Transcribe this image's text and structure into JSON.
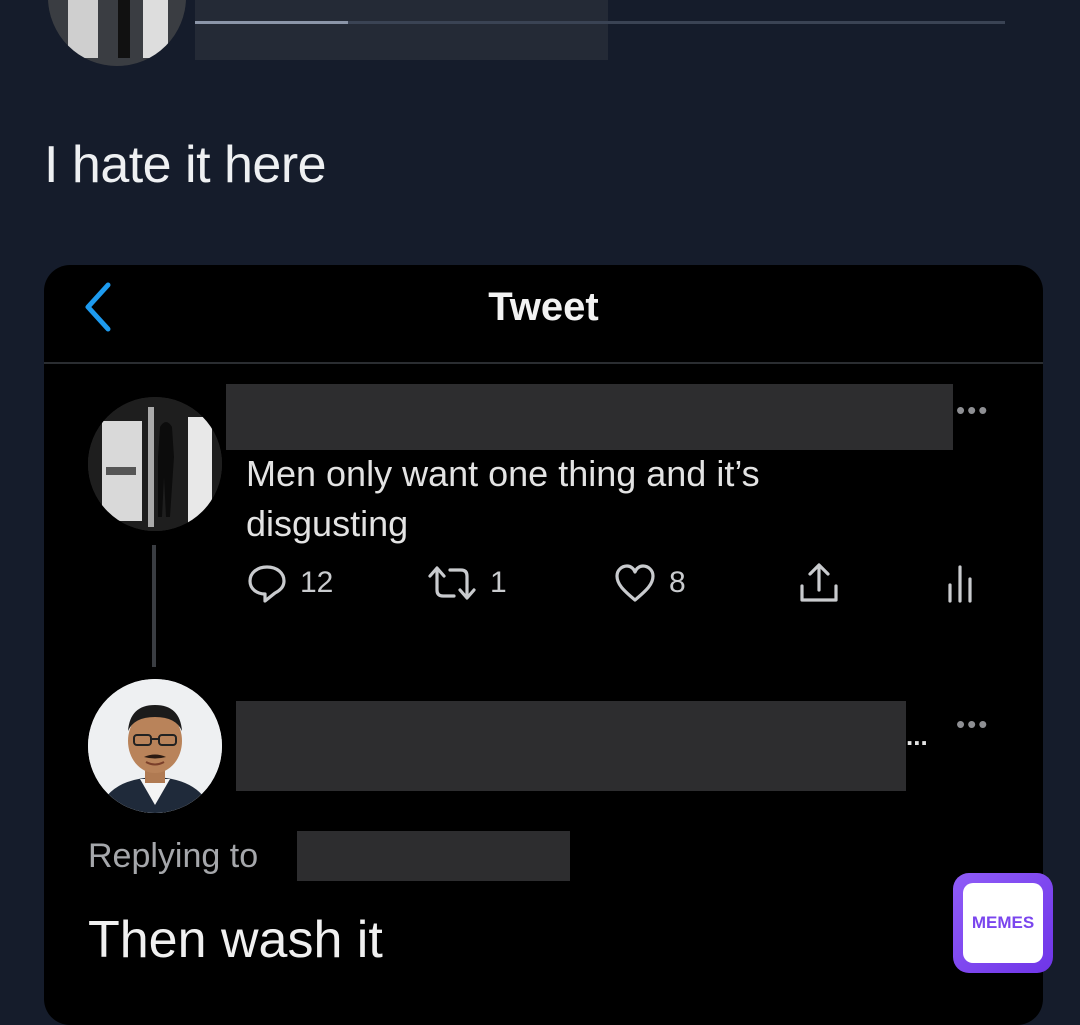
{
  "post": {
    "caption": "I hate it here"
  },
  "embedded": {
    "nav": {
      "title": "Tweet"
    },
    "original_tweet": {
      "text": "Men only want one thing and it’s disgusting",
      "more": "•••",
      "actions": {
        "reply_count": "12",
        "retweet_count": "1",
        "like_count": "8"
      }
    },
    "reply": {
      "more": "•••",
      "name_ellipsis": "...",
      "replying_to_label": "Replying to",
      "text": "Then wash it"
    }
  },
  "watermark": {
    "label": "MEMES"
  },
  "colors": {
    "background": "#151c2b",
    "screenshot_bg": "#000000",
    "accent_blue": "#1d9bf0",
    "watermark_purple": "#7a45ee"
  }
}
